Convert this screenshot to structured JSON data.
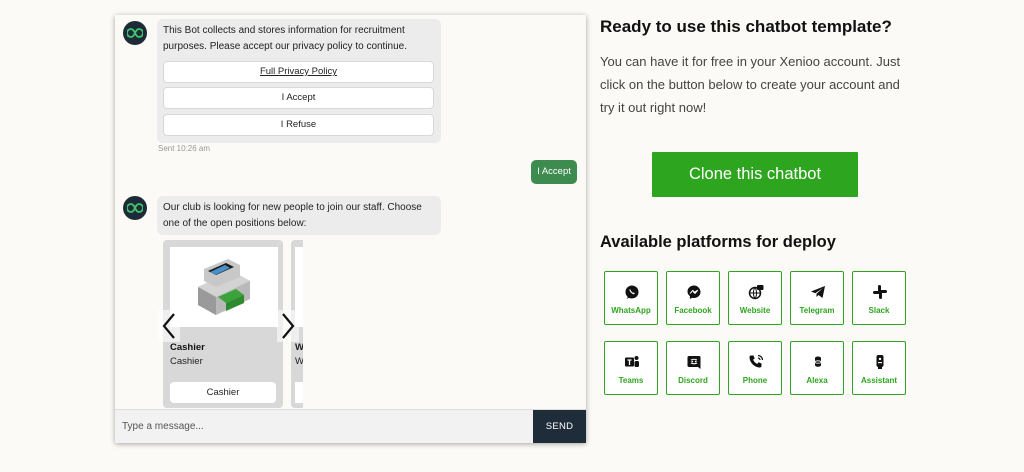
{
  "chat": {
    "privacy_message": "This Bot collects and stores information for recruitment purposes. Please accept our privacy policy to continue.",
    "options": [
      "Full Privacy Policy",
      "I Accept",
      "I Refuse"
    ],
    "timestamp": "Sent 10:26 am",
    "user_reply": "I Accept",
    "positions_message": "Our club is looking for new people to join our staff. Choose one of the open positions below:",
    "cards": [
      {
        "title": "Cashier",
        "subtitle": "Cashier",
        "button": "Cashier"
      },
      {
        "title": "W",
        "subtitle": "W",
        "button": ""
      }
    ],
    "composer": {
      "placeholder": "Type a message...",
      "send_label": "SEND"
    }
  },
  "promo": {
    "title": "Ready to use this chatbot template?",
    "description": "You can have it for free in your Xenioo account. Just click on the button below to create your account and try it out right now!",
    "clone_label": "Clone this chatbot",
    "platforms_title": "Available platforms for deploy",
    "platforms": [
      {
        "label": "WhatsApp",
        "icon": "whatsapp-icon"
      },
      {
        "label": "Facebook",
        "icon": "messenger-icon"
      },
      {
        "label": "Website",
        "icon": "globe-chat-icon"
      },
      {
        "label": "Telegram",
        "icon": "telegram-icon"
      },
      {
        "label": "Slack",
        "icon": "slack-icon"
      },
      {
        "label": "Teams",
        "icon": "teams-icon"
      },
      {
        "label": "Discord",
        "icon": "discord-icon"
      },
      {
        "label": "Phone",
        "icon": "phone-icon"
      },
      {
        "label": "Alexa",
        "icon": "alexa-icon"
      },
      {
        "label": "Assistant",
        "icon": "assistant-icon"
      }
    ]
  },
  "colors": {
    "accent": "#2ea51e",
    "user_bubble": "#3e8b4f",
    "send": "#1f2d3a"
  }
}
